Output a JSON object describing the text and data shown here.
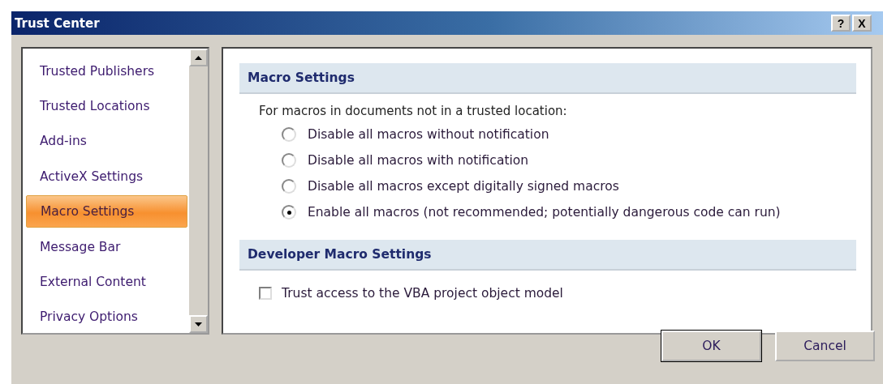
{
  "window": {
    "title": "Trust Center",
    "title_buttons": [
      "?",
      "X"
    ]
  },
  "sidebar": {
    "items": [
      {
        "label": "Trusted Publishers",
        "selected": false
      },
      {
        "label": "Trusted Locations",
        "selected": false
      },
      {
        "label": "Add-ins",
        "selected": false
      },
      {
        "label": "ActiveX Settings",
        "selected": false
      },
      {
        "label": "Macro Settings",
        "selected": true
      },
      {
        "label": "Message Bar",
        "selected": false
      },
      {
        "label": "External Content",
        "selected": false
      },
      {
        "label": "Privacy Options",
        "selected": false
      }
    ]
  },
  "sections": [
    {
      "heading": "Macro Settings",
      "intro": "For macros in documents not in a trusted location:",
      "options": [
        {
          "kind": "radio",
          "label": "Disable all macros without notification",
          "selected": false
        },
        {
          "kind": "radio",
          "label": "Disable all macros with notification",
          "selected": false
        },
        {
          "kind": "radio",
          "label": "Disable all macros except digitally signed macros",
          "selected": false
        },
        {
          "kind": "radio",
          "label": "Enable all macros (not recommended; potentially dangerous code can run)",
          "selected": true
        }
      ]
    },
    {
      "heading": "Developer Macro Settings",
      "options": [
        {
          "kind": "checkbox",
          "label": "Trust access to the VBA project object model",
          "checked": false
        }
      ]
    }
  ],
  "buttons": [
    {
      "label": "OK",
      "default": true
    },
    {
      "label": "Cancel",
      "default": false
    }
  ]
}
